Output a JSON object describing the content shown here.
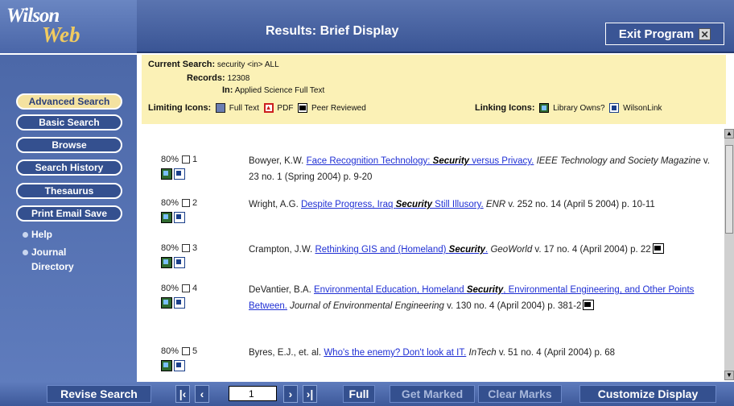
{
  "header": {
    "logo_top": "Wilson",
    "logo_bottom": "Web",
    "title": "Results: Brief Display",
    "exit_label": "Exit Program",
    "exit_icon": "close-icon"
  },
  "sidebar": {
    "buttons": [
      {
        "label": "Advanced Search",
        "active": true
      },
      {
        "label": "Basic Search"
      },
      {
        "label": "Browse"
      },
      {
        "label": "Search History"
      },
      {
        "label": "Thesaurus"
      },
      {
        "label": "Print Email Save"
      }
    ],
    "links": [
      {
        "label": "Help"
      },
      {
        "label": "Journal"
      },
      {
        "label": "Directory"
      }
    ]
  },
  "search_info": {
    "current_search_label": "Current Search:",
    "current_search_value": "security <in> ALL",
    "records_label": "Records:",
    "records_value": "12308",
    "in_label": "In:",
    "in_value": "Applied Science Full Text",
    "limiting_label": "Limiting Icons:",
    "limiting_icons": [
      {
        "icon": "full-text-icon",
        "label": "Full Text"
      },
      {
        "icon": "pdf-icon",
        "label": "PDF"
      },
      {
        "icon": "peer-reviewed-icon",
        "label": "Peer Reviewed"
      }
    ],
    "linking_label": "Linking Icons:",
    "linking_icons": [
      {
        "icon": "library-owns-icon",
        "label": "Library Owns?"
      },
      {
        "icon": "wilsonlink-icon",
        "label": "WilsonLink"
      }
    ]
  },
  "results": [
    {
      "relevance": "80%",
      "number": "1",
      "author": "Bowyer, K.W.",
      "title_before": "Face Recognition Technology: ",
      "title_keyword": "Security",
      "title_after": " versus Privacy.",
      "journal": "IEEE Technology and Society Magazine",
      "details": " v. 23 no. 1 (Spring 2004) p. 9-20",
      "peer_reviewed": false
    },
    {
      "relevance": "80%",
      "number": "2",
      "author": "Wright, A.G.",
      "title_before": "Despite Progress, Iraq ",
      "title_keyword": "Security",
      "title_after": " Still Illusory.",
      "journal": "ENR",
      "details": " v. 252 no. 14 (April 5 2004) p. 10-11",
      "peer_reviewed": false
    },
    {
      "relevance": "80%",
      "number": "3",
      "author": "Crampton, J.W.",
      "title_before": "Rethinking GIS and (Homeland) ",
      "title_keyword": "Security",
      "title_after": ".",
      "journal": "GeoWorld",
      "details": " v. 17 no. 4 (April 2004) p. 22",
      "peer_reviewed": true
    },
    {
      "relevance": "80%",
      "number": "4",
      "author": "DeVantier, B.A.",
      "title_before": "Environmental Education, Homeland ",
      "title_keyword": "Security",
      "title_after": ", Environmental Engineering, and Other Points Between.",
      "journal": "Journal of Environmental Engineering",
      "details": " v. 130 no. 4 (April 2004) p. 381-2",
      "peer_reviewed": true
    },
    {
      "relevance": "80%",
      "number": "5",
      "author": "Byres, E.J., et. al.",
      "title_before": "Who's the enemy? Don't look at IT.",
      "title_keyword": "",
      "title_after": "",
      "journal": "InTech",
      "details": " v. 51 no. 4 (April 2004) p. 68",
      "peer_reviewed": false
    }
  ],
  "toolbar": {
    "revise_label": "Revise Search",
    "page_value": "1",
    "full_label": "Full",
    "get_marked_label": "Get Marked",
    "clear_marks_label": "Clear Marks",
    "customize_label": "Customize Display"
  },
  "colors": {
    "header_blue": "#3a5595",
    "panel_yellow": "#fbf1b6",
    "link_blue": "#1f2fd4",
    "logo_gold": "#f1cb60"
  }
}
